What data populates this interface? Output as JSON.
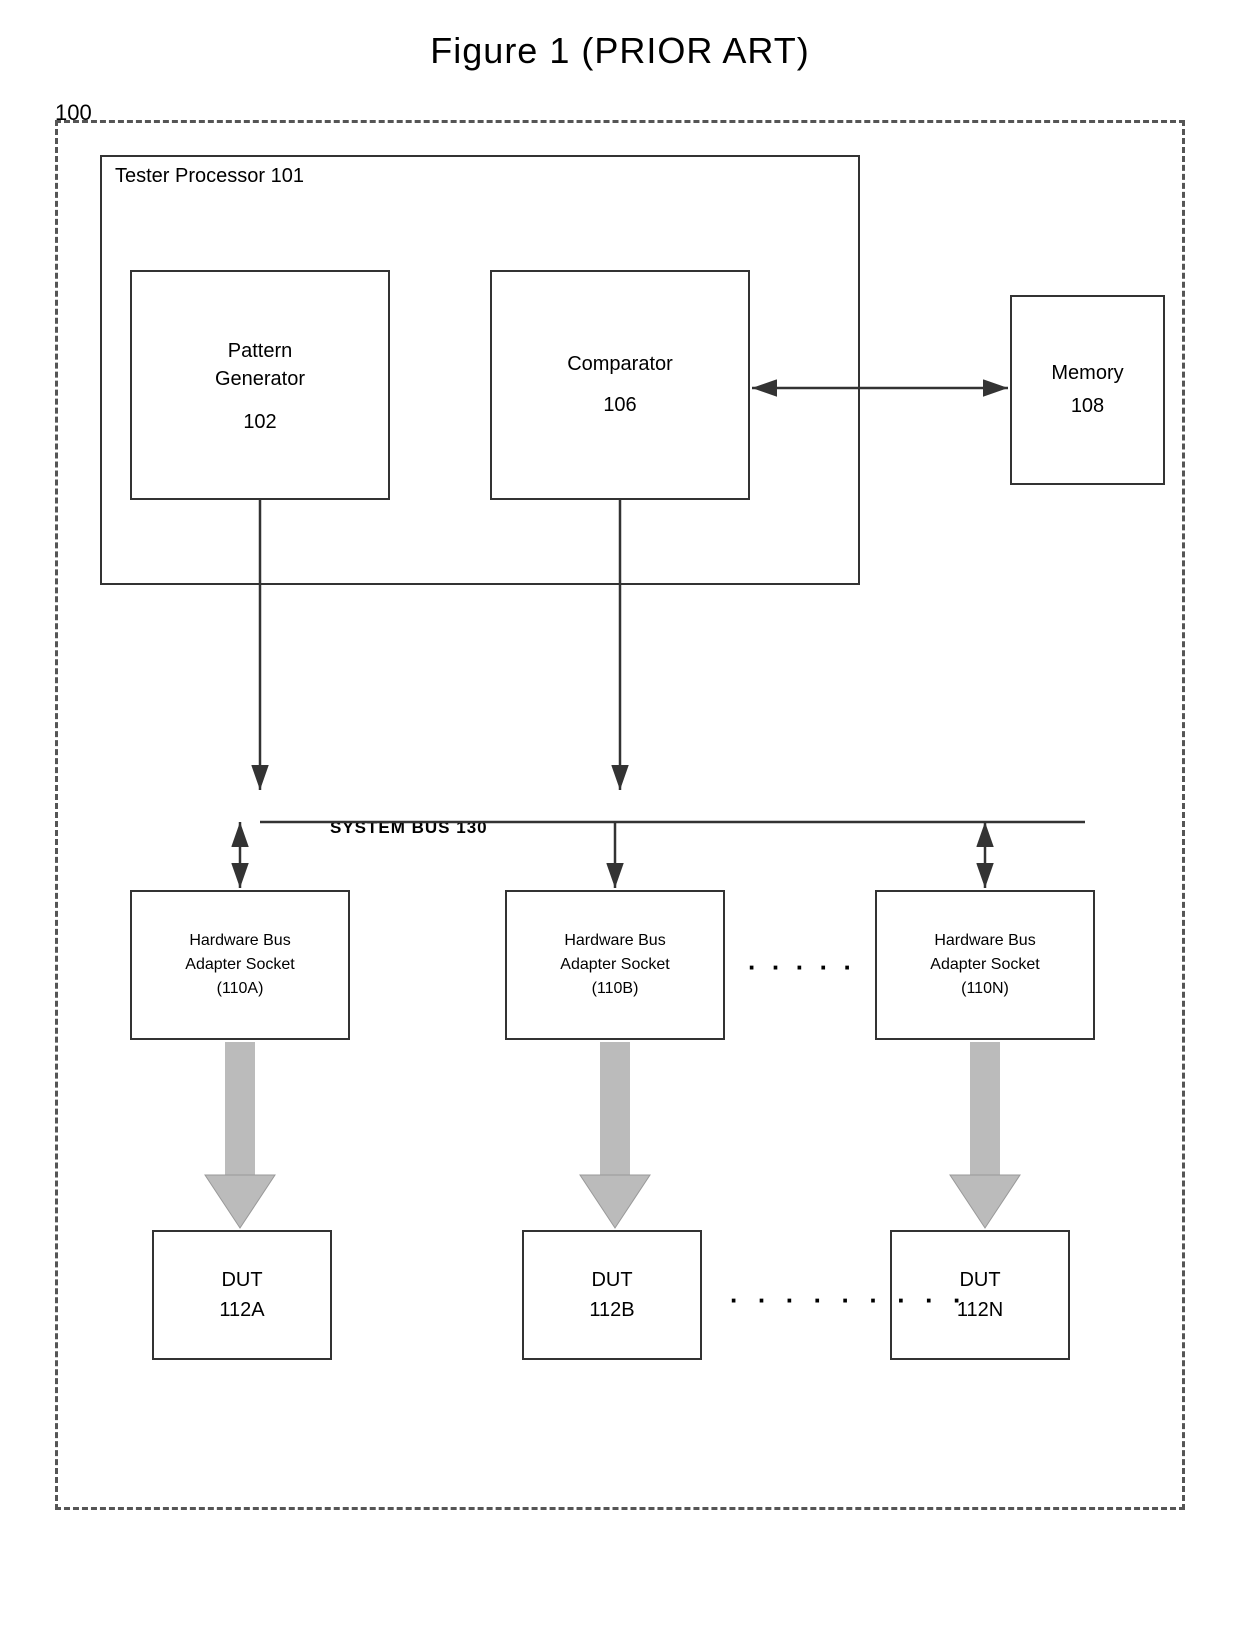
{
  "title": "Figure 1  (PRIOR ART)",
  "diagram": {
    "outer_label": "100",
    "tester_processor": {
      "label": "Tester Processor 101"
    },
    "pattern_generator": {
      "label": "Pattern\nGenerator",
      "number": "102"
    },
    "comparator": {
      "label": "Comparator",
      "number": "106"
    },
    "memory": {
      "label": "Memory",
      "number": "108"
    },
    "system_bus": "SYSTEM BUS 130",
    "hba_a": {
      "label": "Hardware Bus\nAdapter Socket\n(110A)"
    },
    "hba_b": {
      "label": "Hardware Bus\nAdapter Socket\n(110B)"
    },
    "hba_n": {
      "label": "Hardware Bus\nAdapter Socket\n(110N)"
    },
    "dut_a": {
      "label": "DUT\n112A"
    },
    "dut_b": {
      "label": "DUT\n112B"
    },
    "dut_n": {
      "label": "DUT\n112N"
    },
    "ellipsis": "· · · · ·",
    "ellipsis_dut": "· · · · · · · · ·"
  }
}
